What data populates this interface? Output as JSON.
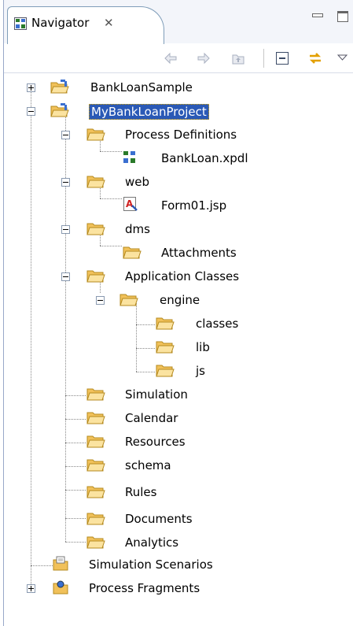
{
  "tab": {
    "label": "Navigator",
    "close_glyph": "✕"
  },
  "toolbar": {
    "icons": [
      "back-arrow-icon",
      "forward-arrow-icon",
      "up-folder-icon",
      "collapse-all-icon",
      "link-with-editor-icon",
      "view-menu-icon"
    ]
  },
  "tree": {
    "items": [
      {
        "label": "BankLoanSample",
        "icon": "project-icon",
        "expanded": false,
        "selected": false
      },
      {
        "label": "MyBankLoanProject",
        "icon": "project-icon",
        "expanded": true,
        "selected": true
      },
      {
        "label": "Process Definitions",
        "icon": "folder-icon",
        "expanded": true
      },
      {
        "label": "BankLoan.xpdl",
        "icon": "xpdl-file-icon"
      },
      {
        "label": "web",
        "icon": "folder-icon",
        "expanded": true
      },
      {
        "label": "Form01.jsp",
        "icon": "jsp-file-icon"
      },
      {
        "label": "dms",
        "icon": "folder-icon",
        "expanded": true
      },
      {
        "label": "Attachments",
        "icon": "folder-icon"
      },
      {
        "label": "Application Classes",
        "icon": "folder-icon",
        "expanded": true
      },
      {
        "label": "engine",
        "icon": "folder-icon",
        "expanded": true
      },
      {
        "label": "classes",
        "icon": "folder-icon"
      },
      {
        "label": "lib",
        "icon": "folder-icon"
      },
      {
        "label": "js",
        "icon": "folder-icon"
      },
      {
        "label": "Simulation",
        "icon": "folder-icon"
      },
      {
        "label": "Calendar",
        "icon": "folder-icon"
      },
      {
        "label": "Resources",
        "icon": "folder-icon"
      },
      {
        "label": "schema",
        "icon": "folder-icon"
      },
      {
        "label": "Rules",
        "icon": "folder-icon"
      },
      {
        "label": "Documents",
        "icon": "folder-icon"
      },
      {
        "label": "Analytics",
        "icon": "folder-icon"
      },
      {
        "label": "Simulation Scenarios",
        "icon": "scenario-icon"
      },
      {
        "label": "Process Fragments",
        "icon": "fragment-icon",
        "expanded": false
      }
    ]
  },
  "colors": {
    "selection": "#2a59b6",
    "folder": "#f5c865",
    "tab_border": "#7f9db9"
  }
}
